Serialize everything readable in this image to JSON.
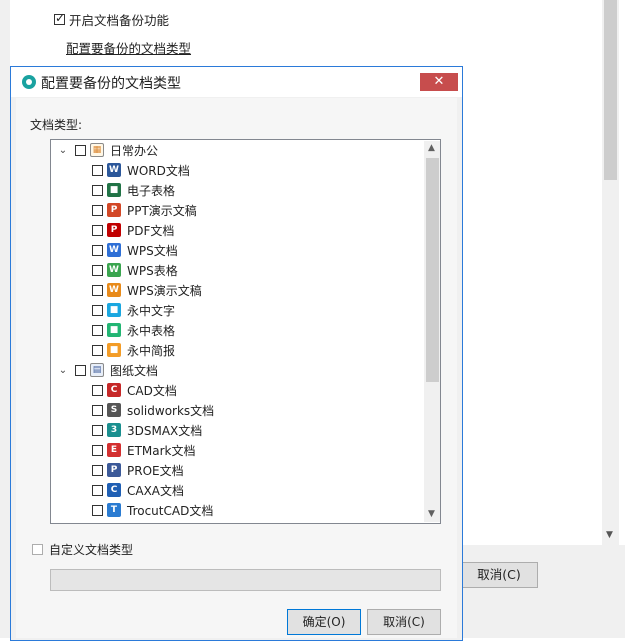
{
  "background": {
    "enable_backup_label": "开启文档备份功能",
    "enable_backup_checked": true,
    "configure_link": "配置要备份的文档类型",
    "cancel_label": "取消(C)"
  },
  "dialog": {
    "title": "配置要备份的文档类型",
    "close_symbol": "✕",
    "types_label": "文档类型:",
    "groups": [
      {
        "label": "日常办公",
        "expanded": true,
        "items": [
          {
            "label": "WORD文档",
            "icon": "word-doc-icon",
            "color": "#2b579a"
          },
          {
            "label": "电子表格",
            "icon": "excel-icon",
            "color": "#217346"
          },
          {
            "label": "PPT演示文稿",
            "icon": "ppt-icon",
            "color": "#d24726"
          },
          {
            "label": "PDF文档",
            "icon": "pdf-icon",
            "color": "#c00000"
          },
          {
            "label": "WPS文档",
            "icon": "wps-writer-icon",
            "color": "#2e6fd6"
          },
          {
            "label": "WPS表格",
            "icon": "wps-sheet-icon",
            "color": "#3aa54f"
          },
          {
            "label": "WPS演示文稿",
            "icon": "wps-present-icon",
            "color": "#e88a1a"
          },
          {
            "label": "永中文字",
            "icon": "yozo-writer-icon",
            "color": "#1aa7e0"
          },
          {
            "label": "永中表格",
            "icon": "yozo-sheet-icon",
            "color": "#22b573"
          },
          {
            "label": "永中简报",
            "icon": "yozo-present-icon",
            "color": "#f39c27"
          }
        ]
      },
      {
        "label": "图纸文档",
        "expanded": true,
        "items": [
          {
            "label": "CAD文档",
            "icon": "cad-icon",
            "color": "#c62828"
          },
          {
            "label": "solidworks文档",
            "icon": "solidworks-icon",
            "color": "#555555"
          },
          {
            "label": "3DSMAX文档",
            "icon": "3dsmax-icon",
            "color": "#1a8f8f"
          },
          {
            "label": "ETMark文档",
            "icon": "etmark-icon",
            "color": "#d32f2f"
          },
          {
            "label": "PROE文档",
            "icon": "proe-icon",
            "color": "#3b5998"
          },
          {
            "label": "CAXA文档",
            "icon": "caxa-icon",
            "color": "#1f5fb4"
          },
          {
            "label": "TrocutCAD文档",
            "icon": "trocutcad-icon",
            "color": "#2a7bd1"
          }
        ]
      }
    ],
    "custom_type_label": "自定义文档类型",
    "custom_type_value": "",
    "ok_label": "确定(O)",
    "cancel_label": "取消(C)"
  }
}
